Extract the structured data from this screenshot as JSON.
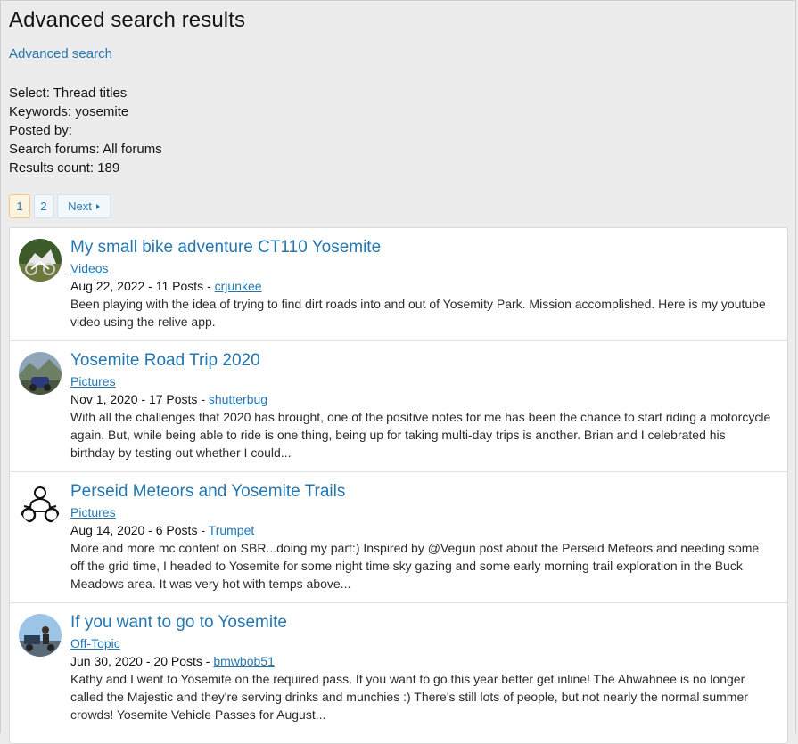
{
  "page": {
    "title": "Advanced search results",
    "advanced_search_link": "Advanced search"
  },
  "criteria": [
    {
      "label": "Select:",
      "value": "Thread titles"
    },
    {
      "label": "Keywords:",
      "value": "yosemite"
    },
    {
      "label": "Posted by:",
      "value": ""
    },
    {
      "label": "Search forums:",
      "value": "All forums"
    },
    {
      "label": "Results count:",
      "value": "189"
    }
  ],
  "pagination": {
    "current": "1",
    "pages": [
      "1",
      "2"
    ],
    "next_label": "Next"
  },
  "results": [
    {
      "title": "My small bike adventure CT110 Yosemite",
      "forum": "Videos",
      "date": "Aug 22, 2022",
      "posts": "11 Posts",
      "user": "crjunkee",
      "snippet_lines": [
        "Been playing with the idea of trying to find dirt roads into and out of Yosemity Park. Mission accomplished. Here is my youtube",
        "video using the relive app."
      ],
      "avatar_icon": "bike-rider-avatar"
    },
    {
      "title": "Yosemite Road Trip 2020",
      "forum": "Pictures",
      "date": "Nov 1, 2020",
      "posts": "17 Posts",
      "user": "shutterbug",
      "snippet_lines": [
        "With all the challenges that 2020 has brought, one of the positive notes for me has been the chance to start riding a motorcycle",
        "again. But, while being able to ride is one thing, being up for taking multi-day trips is another. Brian and I celebrated his",
        "birthday by testing out whether I could..."
      ],
      "avatar_icon": "motorcycle-landscape-avatar"
    },
    {
      "title": "Perseid Meteors and Yosemite Trails",
      "forum": "Pictures",
      "date": "Aug 14, 2020",
      "posts": "6 Posts",
      "user": "Trumpet",
      "snippet_lines": [
        "More and more mc content on SBR...doing my part:) Inspired by @Vegun post about the Perseid Meteors and needing some",
        "off the grid time, I headed to Yosemite for some night time sky gazing and some early morning trail exploration in the Buck",
        "Meadows area. It was very hot with temps above..."
      ],
      "avatar_icon": "cartoon-rider-avatar"
    },
    {
      "title": "If you want to go to Yosemite",
      "forum": "Off-Topic",
      "date": "Jun 30, 2020",
      "posts": "20 Posts",
      "user": "bmwbob51",
      "snippet_lines": [
        "Kathy and I went to Yosemite on the required pass. If you want to go this year better get inline! The Ahwahnee is no longer",
        "called the Majestic and they're serving drinks and munchies :) There's still lots of people, but not nearly the normal summer",
        "crowds! Yosemite Vehicle Passes for August..."
      ],
      "avatar_icon": "rider-sky-avatar"
    }
  ],
  "colors": {
    "link": "#2577b1",
    "background": "#ececec",
    "current_page_border": "#f0c887"
  }
}
